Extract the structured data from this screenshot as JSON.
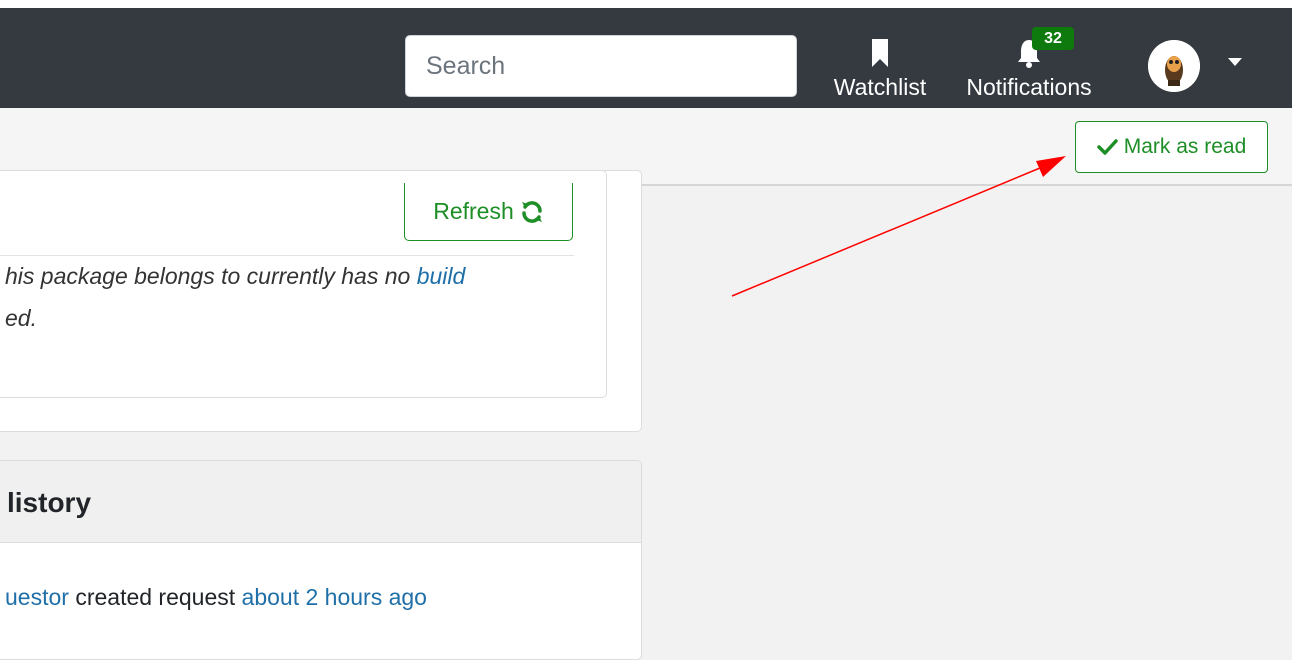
{
  "navbar": {
    "search": {
      "placeholder": "Search",
      "value": ""
    },
    "watchlist": {
      "label": "Watchlist",
      "icon": "bookmark-icon"
    },
    "notifications": {
      "label": "Notifications",
      "icon": "bell-icon",
      "count": "32"
    },
    "user_menu": {
      "icon": "caret-down-icon"
    }
  },
  "toolbar": {
    "mark_read_label": "Mark as read",
    "mark_read_icon": "check-icon"
  },
  "build_card": {
    "refresh_label": "Refresh",
    "refresh_icon": "refresh-icon",
    "text_line1_prefix": "his package belongs to currently has no ",
    "text_line1_link": "build",
    "text_line2": "ed."
  },
  "history": {
    "title": "History",
    "title_visible": "listory",
    "entry": {
      "user": "uestor",
      "action": " created request ",
      "time": "about 2 hours ago"
    }
  },
  "colors": {
    "navbar_bg": "#343a40",
    "accent_green": "#1e8f26",
    "badge_green": "#0e7a0d",
    "link_blue": "#1f6fa8",
    "annotation_red": "#ff0000"
  }
}
